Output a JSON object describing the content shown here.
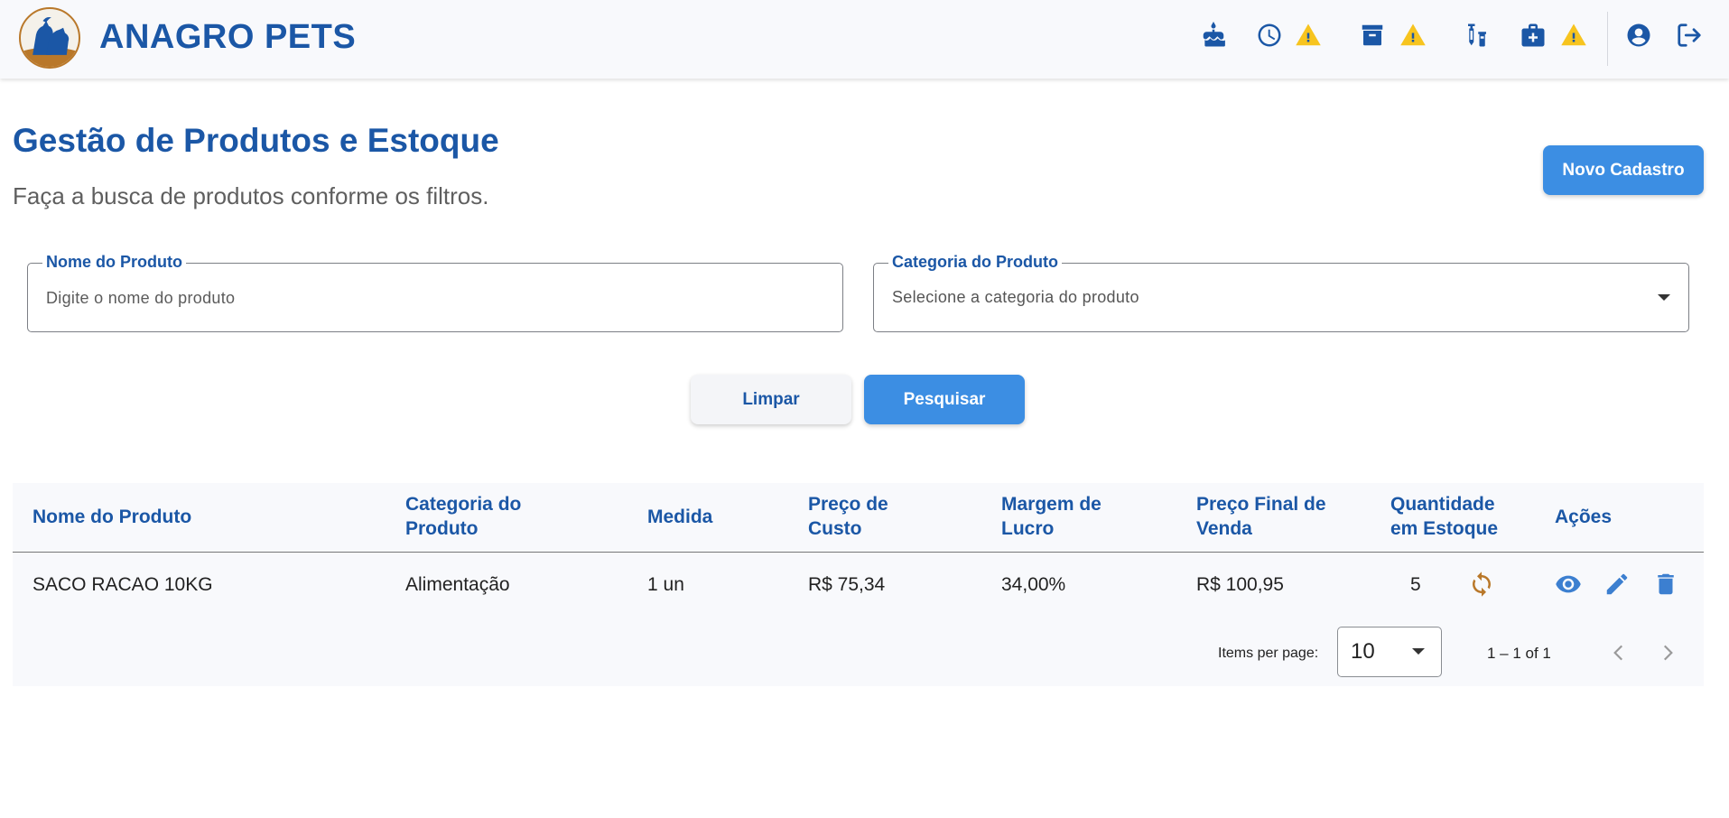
{
  "brand": {
    "name": "ANAGRO PETS"
  },
  "topbar": {
    "icons": [
      "cake-icon",
      "clock-icon",
      "warning-icon",
      "archive-icon",
      "warning-icon",
      "vaccine-icon",
      "medkit-icon",
      "warning-icon",
      "account-icon",
      "logout-icon"
    ]
  },
  "header": {
    "title": "Gestão de Produtos e Estoque",
    "subtitle": "Faça a busca de produtos conforme os filtros.",
    "new_button": "Novo Cadastro"
  },
  "filters": {
    "name_label": "Nome do Produto",
    "name_placeholder": "Digite o nome do produto",
    "name_value": "",
    "category_label": "Categoria do Produto",
    "category_placeholder": "Selecione a categoria do produto"
  },
  "actions": {
    "clear": "Limpar",
    "search": "Pesquisar"
  },
  "table": {
    "headers": {
      "name": "Nome do Produto",
      "category_l1": "Categoria do",
      "category_l2": "Produto",
      "measure": "Medida",
      "cost_l1": "Preço de",
      "cost_l2": "Custo",
      "margin_l1": "Margem de",
      "margin_l2": "Lucro",
      "final_l1": "Preço Final de",
      "final_l2": "Venda",
      "qty_l1": "Quantidade",
      "qty_l2": "em Estoque",
      "actions": "Ações"
    },
    "rows": [
      {
        "name": "SACO RACAO 10KG",
        "category": "Alimentação",
        "measure": "1 un",
        "cost": "R$ 75,34",
        "margin": "34,00%",
        "final_price": "R$ 100,95",
        "quantity": "5"
      }
    ]
  },
  "paginator": {
    "items_label": "Items per page:",
    "page_size": "10",
    "range": "1 – 1 of 1"
  },
  "colors": {
    "brand_blue": "#1b57a6",
    "accent_blue": "#3c8ee3",
    "warning": "#f7c41f",
    "refresh": "#b9782a"
  }
}
